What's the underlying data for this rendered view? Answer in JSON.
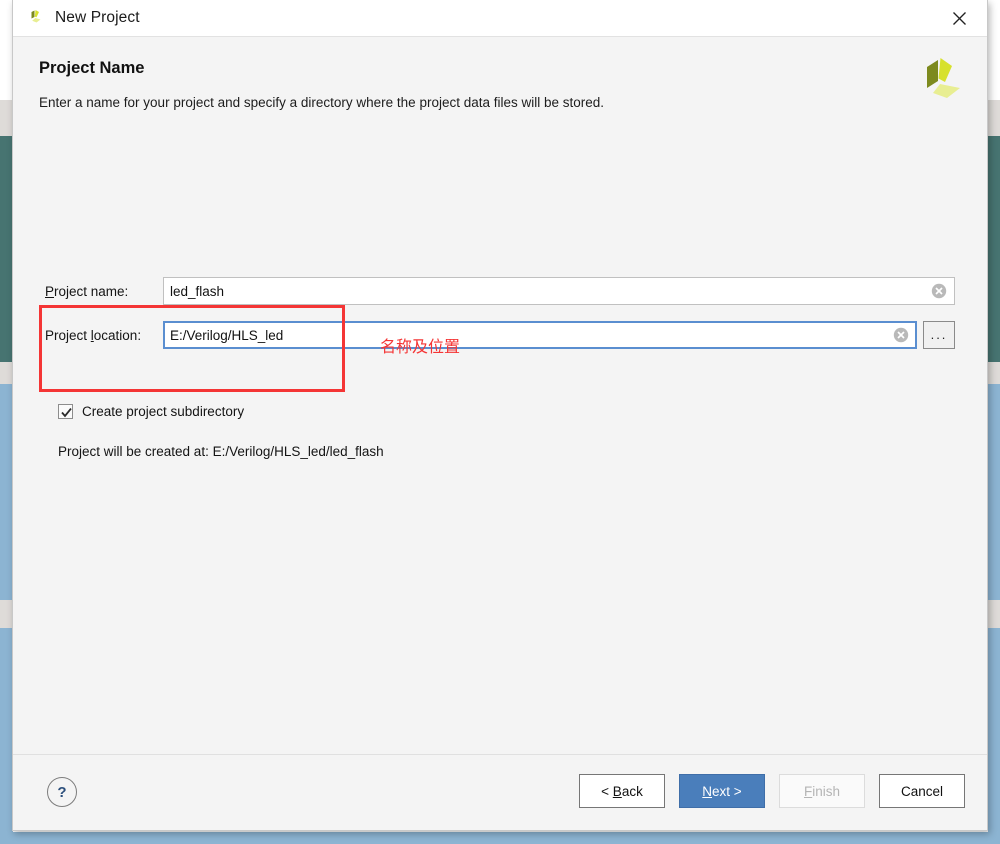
{
  "window": {
    "title": "New Project",
    "app_icon": "vitis-logo-icon",
    "close_icon": "close-icon"
  },
  "header": {
    "title": "Project Name",
    "subtitle": "Enter a name for your project and specify a directory where the project data files will be stored.",
    "brand_icon": "vitis-logo-icon"
  },
  "form": {
    "project_name": {
      "label_prefix": "P",
      "label_rest": "roject name:",
      "value": "led_flash",
      "clear_icon": "clear-circle-icon"
    },
    "project_location": {
      "label_prefix_before": "Project ",
      "label_underlined": "l",
      "label_rest": "ocation:",
      "value": "E:/Verilog/HLS_led",
      "clear_icon": "clear-circle-icon",
      "browse_label": "..."
    },
    "checkbox": {
      "label": "Create project subdirectory",
      "checked": true,
      "check_icon": "checkmark-icon"
    },
    "created_at_text": "Project will be created at: E:/Verilog/HLS_led/led_flash"
  },
  "annotation": {
    "note_text": "名称及位置",
    "color": "#f43535"
  },
  "footer": {
    "help_label": "?",
    "help_icon": "question-mark-icon",
    "buttons": [
      {
        "name": "back",
        "prefix": "< ",
        "accel": "B",
        "suffix": "ack",
        "state": "enabled"
      },
      {
        "name": "next",
        "prefix": "",
        "accel": "N",
        "suffix": "ext >",
        "state": "primary"
      },
      {
        "name": "finish",
        "prefix": "",
        "accel": "F",
        "suffix": "inish",
        "state": "disabled"
      },
      {
        "name": "cancel",
        "prefix": "",
        "accel": "",
        "suffix": "Cancel",
        "state": "enabled"
      }
    ]
  },
  "colors": {
    "primary_button": "#4a7ebb",
    "focus_border": "#5a8ed0",
    "annotation_red": "#f43535",
    "logo_dark": "#7d8a1e",
    "logo_mid": "#d7e12c",
    "logo_light": "#e8ee92",
    "backdrop_teal": "#477471",
    "backdrop_blue": "#8cb4d2"
  }
}
